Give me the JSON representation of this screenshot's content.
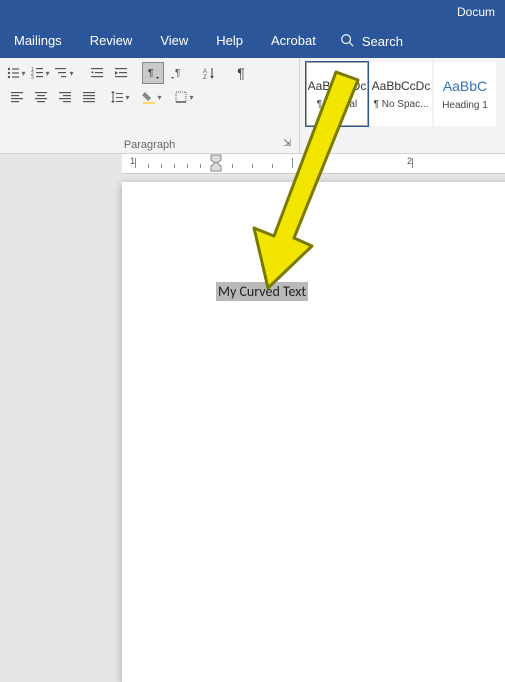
{
  "title_bar": {
    "title": "Docum"
  },
  "tabs": {
    "mailings": "Mailings",
    "review": "Review",
    "view": "View",
    "help": "Help",
    "acrobat": "Acrobat",
    "search": "Search"
  },
  "ribbon": {
    "paragraph": {
      "label": "Paragraph",
      "dialog_icon": "⇲"
    },
    "styles": {
      "preview": "AaBbCcDc",
      "heading_preview": "AaBbC",
      "normal": "¶ Normal",
      "no_spacing": "¶ No Spac...",
      "heading1": "Heading 1"
    }
  },
  "ruler": {
    "marks": [
      "1",
      "2"
    ]
  },
  "document": {
    "selected_text": "My Curved Text"
  },
  "colors": {
    "word_blue": "#2b579a",
    "arrow_fill": "#f2e600",
    "arrow_stroke": "#7a7a00"
  }
}
